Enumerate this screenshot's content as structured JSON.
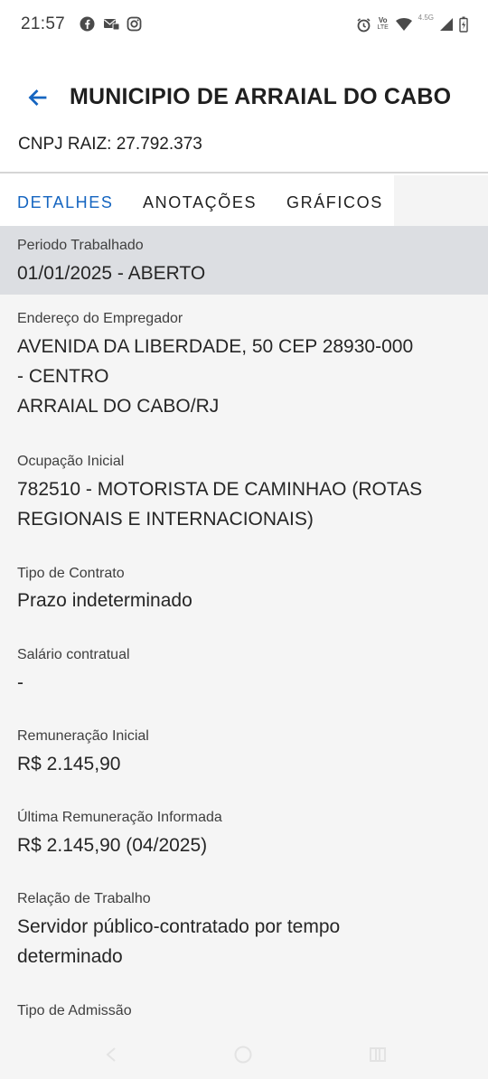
{
  "status_bar": {
    "time": "21:57",
    "left_icons": [
      "facebook-icon",
      "mail-icon",
      "instagram-icon"
    ],
    "right_icons": [
      "alarm-icon",
      "volte-icon",
      "wifi-icon",
      "signal-icon",
      "battery-icon"
    ],
    "network_label": "4.5G",
    "volte_top": "Vo",
    "volte_bottom": "LTE"
  },
  "header": {
    "back_icon": "arrow-left-icon",
    "title": "MUNICIPIO DE ARRAIAL DO CABO",
    "subtitle": "CNPJ RAIZ: 27.792.373"
  },
  "tabs": [
    {
      "label": "DETALHES",
      "active": true
    },
    {
      "label": "ANOTAÇÕES",
      "active": false
    },
    {
      "label": "GRÁFICOS",
      "active": false
    }
  ],
  "fields": [
    {
      "label": "Periodo Trabalhado",
      "value_lines": [
        "01/01/2025 - ABERTO"
      ]
    },
    {
      "label": "Endereço do Empregador",
      "value_lines": [
        "AVENIDA DA LIBERDADE, 50 CEP 28930-000",
        "- CENTRO",
        "ARRAIAL DO CABO/RJ"
      ]
    },
    {
      "label": "Ocupação Inicial",
      "value_lines": [
        "782510 - MOTORISTA DE CAMINHAO (ROTAS",
        "REGIONAIS E INTERNACIONAIS)"
      ]
    },
    {
      "label": "Tipo de Contrato",
      "value_lines": [
        "Prazo indeterminado"
      ]
    },
    {
      "label": "Salário contratual",
      "value_lines": [
        "-"
      ]
    },
    {
      "label": "Remuneração Inicial",
      "value_lines": [
        "R$ 2.145,90"
      ]
    },
    {
      "label": "Última Remuneração Informada",
      "value_lines": [
        "R$ 2.145,90 (04/2025)"
      ]
    },
    {
      "label": "Relação de Trabalho",
      "value_lines": [
        "Servidor público-contratado por tempo",
        "determinado"
      ]
    },
    {
      "label": "Tipo de Admissão",
      "value_lines": []
    }
  ],
  "colors": {
    "accent": "#1565c0",
    "highlight": "#dcdee2",
    "content_bg": "#f5f5f5"
  },
  "nav_bar": {
    "icons": [
      "back-nav-icon",
      "home-nav-icon",
      "recents-nav-icon"
    ]
  }
}
